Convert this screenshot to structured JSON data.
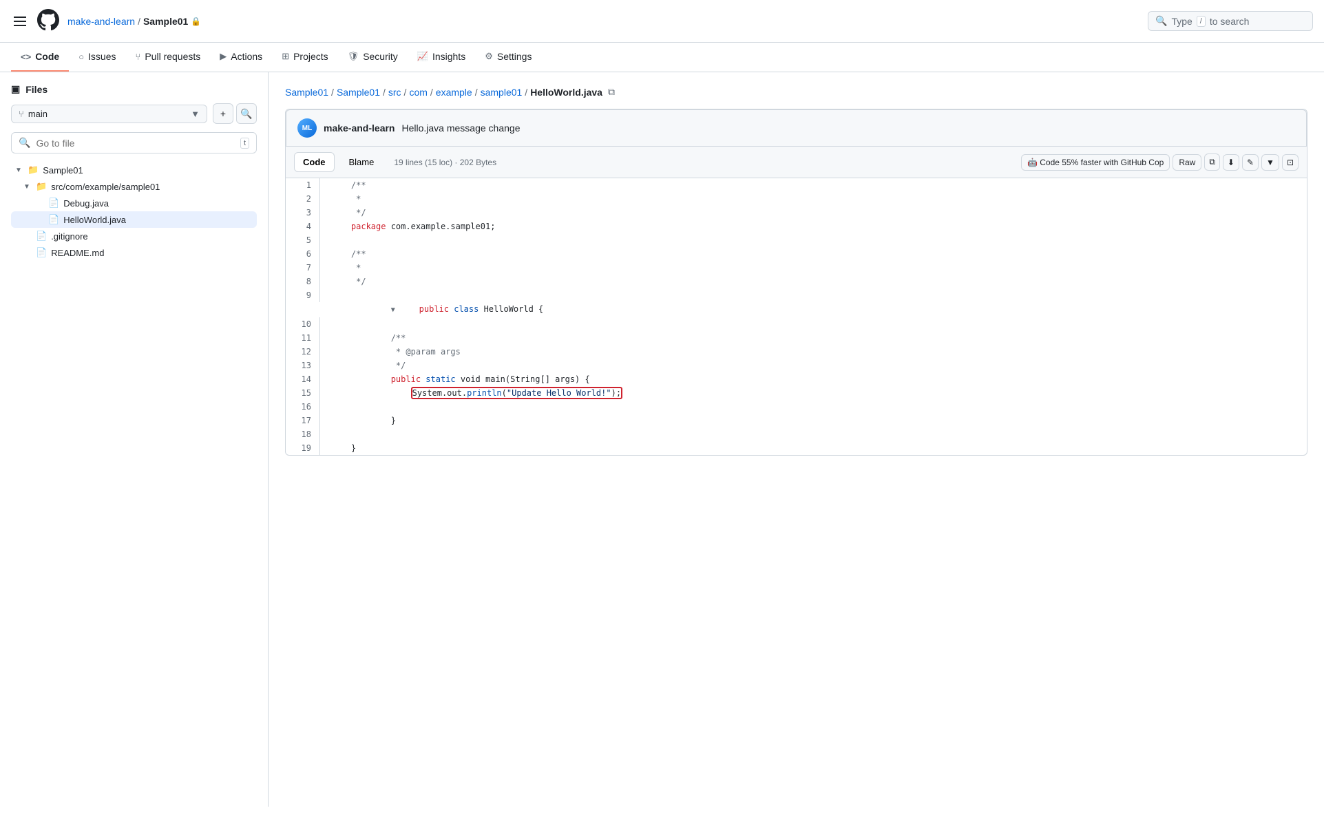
{
  "app": {
    "hamburger_label": "☰",
    "org": "make-and-learn",
    "separator": "/",
    "repo": "Sample01",
    "lock": "🔒"
  },
  "search": {
    "placeholder": "Type",
    "slash_kbd": "/",
    "suffix": "to search"
  },
  "nav": {
    "items": [
      {
        "id": "code",
        "label": "Code",
        "icon": "<>",
        "active": true
      },
      {
        "id": "issues",
        "label": "Issues",
        "icon": "○"
      },
      {
        "id": "pull-requests",
        "label": "Pull requests",
        "icon": "⑂"
      },
      {
        "id": "actions",
        "label": "Actions",
        "icon": "▶"
      },
      {
        "id": "projects",
        "label": "Projects",
        "icon": "⊞"
      },
      {
        "id": "security",
        "label": "Security",
        "icon": "🛡"
      },
      {
        "id": "insights",
        "label": "Insights",
        "icon": "📈"
      },
      {
        "id": "settings",
        "label": "Settings",
        "icon": "⚙"
      }
    ]
  },
  "sidebar": {
    "files_label": "Files",
    "branch": "main",
    "add_btn": "+",
    "search_btn": "🔍",
    "go_to_file_placeholder": "Go to file",
    "kbd_t": "t",
    "tree": [
      {
        "id": "sample01-root",
        "label": "Sample01",
        "type": "folder",
        "level": 0,
        "expanded": true
      },
      {
        "id": "src-folder",
        "label": "src/com/example/sample01",
        "type": "folder",
        "level": 1,
        "expanded": true
      },
      {
        "id": "debug-java",
        "label": "Debug.java",
        "type": "file",
        "level": 2
      },
      {
        "id": "helloworld-java",
        "label": "HelloWorld.java",
        "type": "file",
        "level": 2,
        "active": true
      },
      {
        "id": "gitignore",
        "label": ".gitignore",
        "type": "file",
        "level": 1
      },
      {
        "id": "readme",
        "label": "README.md",
        "type": "file",
        "level": 1
      }
    ]
  },
  "breadcrumb": {
    "parts": [
      {
        "label": "Sample01",
        "link": true
      },
      {
        "label": "/",
        "link": false
      },
      {
        "label": "Sample01",
        "link": true
      },
      {
        "label": "/",
        "link": false
      },
      {
        "label": "src",
        "link": true
      },
      {
        "label": "/",
        "link": false
      },
      {
        "label": "com",
        "link": true
      },
      {
        "label": "/",
        "link": false
      },
      {
        "label": "example",
        "link": true
      },
      {
        "label": "/",
        "link": false
      },
      {
        "label": "sample01",
        "link": true
      },
      {
        "label": "/",
        "link": false
      },
      {
        "label": "HelloWorld.java",
        "link": false
      }
    ],
    "copy_tooltip": "Copy path"
  },
  "commit": {
    "avatar_initials": "ML",
    "user": "make-and-learn",
    "message": "Hello.java message change"
  },
  "file_viewer": {
    "tab_code": "Code",
    "tab_blame": "Blame",
    "meta": "19 lines (15 loc) · 202 Bytes",
    "copilot_label": "Code 55% faster with GitHub Cop",
    "raw_label": "Raw",
    "actions": [
      "copy",
      "download",
      "edit",
      "chevron",
      "panel"
    ]
  },
  "code": {
    "lines": [
      {
        "num": 1,
        "content": "    /**",
        "type": "comment"
      },
      {
        "num": 2,
        "content": "     *",
        "type": "comment"
      },
      {
        "num": 3,
        "content": "     */",
        "type": "comment"
      },
      {
        "num": 4,
        "content": "    package com.example.sample01;",
        "type": "package"
      },
      {
        "num": 5,
        "content": "",
        "type": "blank"
      },
      {
        "num": 6,
        "content": "    /**",
        "type": "comment"
      },
      {
        "num": 7,
        "content": "     *",
        "type": "comment"
      },
      {
        "num": 8,
        "content": "     */",
        "type": "comment"
      },
      {
        "num": 9,
        "content": "    public class HelloWorld {",
        "type": "class",
        "collapse": true
      },
      {
        "num": 10,
        "content": "",
        "type": "blank"
      },
      {
        "num": 11,
        "content": "            /**",
        "type": "comment"
      },
      {
        "num": 12,
        "content": "             * @param args",
        "type": "comment"
      },
      {
        "num": 13,
        "content": "             */",
        "type": "comment"
      },
      {
        "num": 14,
        "content": "            public static void main(String[] args) {",
        "type": "method"
      },
      {
        "num": 15,
        "content": "                System.out.println(\"Update Hello World!\");",
        "type": "highlight"
      },
      {
        "num": 16,
        "content": "",
        "type": "blank"
      },
      {
        "num": 17,
        "content": "            }",
        "type": "normal"
      },
      {
        "num": 18,
        "content": "",
        "type": "blank"
      },
      {
        "num": 19,
        "content": "    }",
        "type": "normal"
      }
    ]
  }
}
